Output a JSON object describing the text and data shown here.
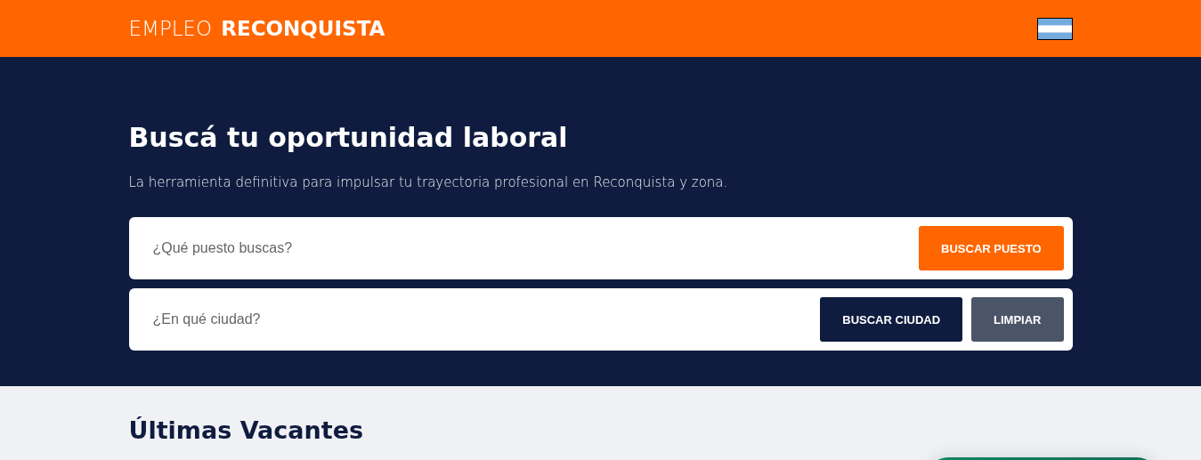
{
  "header": {
    "brand_light": "EMPLEO",
    "brand_bold": "RECONQUISTA"
  },
  "hero": {
    "title": "Buscá tu oportunidad laboral",
    "subtitle": "La herramienta definitiva para impulsar tu trayectoria profesional en Reconquista y zona."
  },
  "search_rows": [
    {
      "placeholder": "¿Qué puesto buscas?",
      "buttons": [
        {
          "label": "BUSCAR PUESTO",
          "kind": "primary"
        }
      ]
    },
    {
      "placeholder": "¿En qué ciudad?",
      "buttons": [
        {
          "label": "BUSCAR CIUDAD",
          "kind": "dark"
        },
        {
          "label": "LIMPIAR",
          "kind": "muted"
        }
      ]
    }
  ],
  "section": {
    "title": "Últimas Vacantes"
  }
}
